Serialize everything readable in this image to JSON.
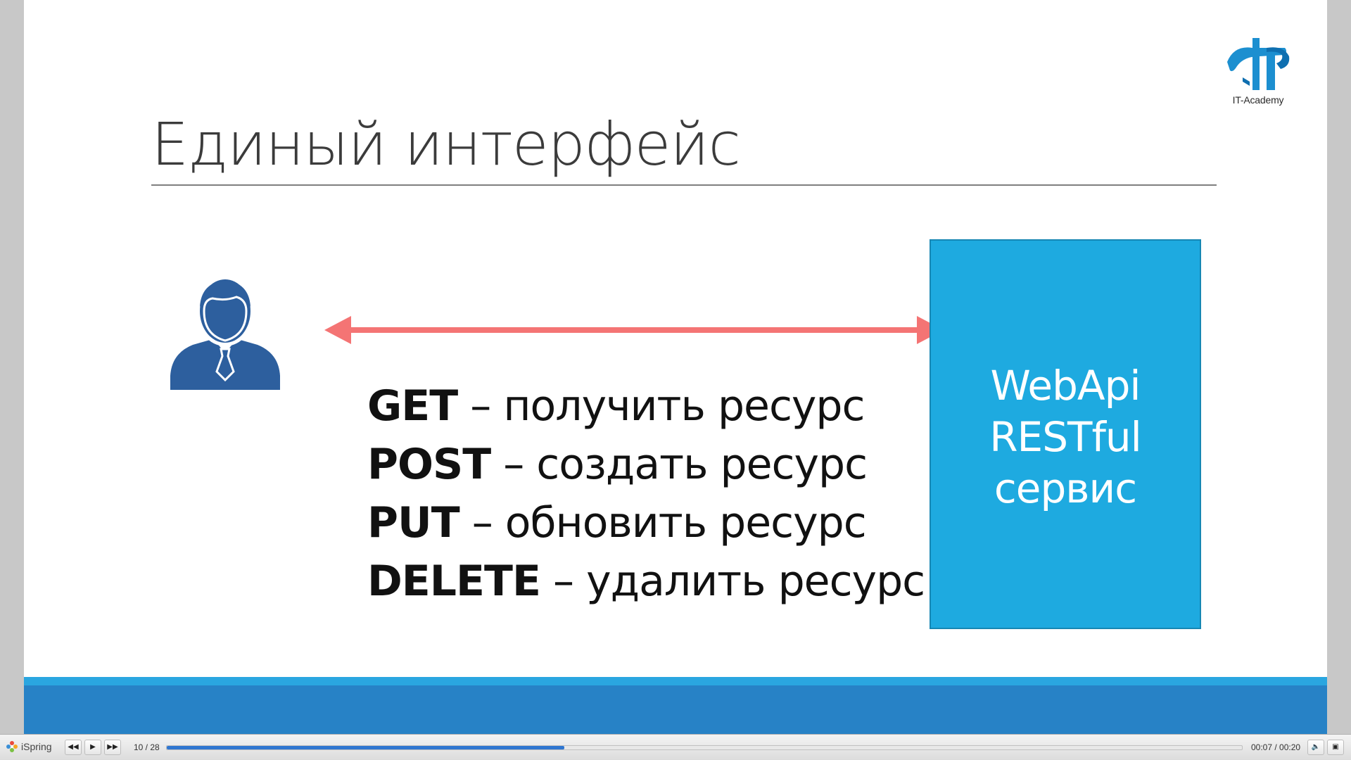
{
  "slide": {
    "title": "Единый интерфейс",
    "logo_text": "IT-Academy",
    "methods": [
      {
        "verb": "GET",
        "description": " – получить ресурс"
      },
      {
        "verb": "POST",
        "description": " – создать ресурс"
      },
      {
        "verb": "PUT",
        "description": " – обновить ресурс"
      },
      {
        "verb": "DELETE",
        "description": " – удалить ресурс"
      }
    ],
    "service_box": {
      "lines": [
        "WebApi",
        "RESTful",
        "сервис"
      ]
    },
    "colors": {
      "accent_blue": "#1eaae0",
      "arrow": "#f47474",
      "user_icon": "#2d5f9e",
      "band_dark": "#2782c6"
    }
  },
  "player": {
    "brand": "iSpring",
    "slide_counter": "10 / 28",
    "time": "00:07 / 00:20",
    "progress": 0.37,
    "controls": {
      "prev_icon": "rewind-icon",
      "play_icon": "play-icon",
      "next_icon": "fast-forward-icon",
      "volume_icon": "volume-icon",
      "fullscreen_icon": "window-icon"
    }
  }
}
